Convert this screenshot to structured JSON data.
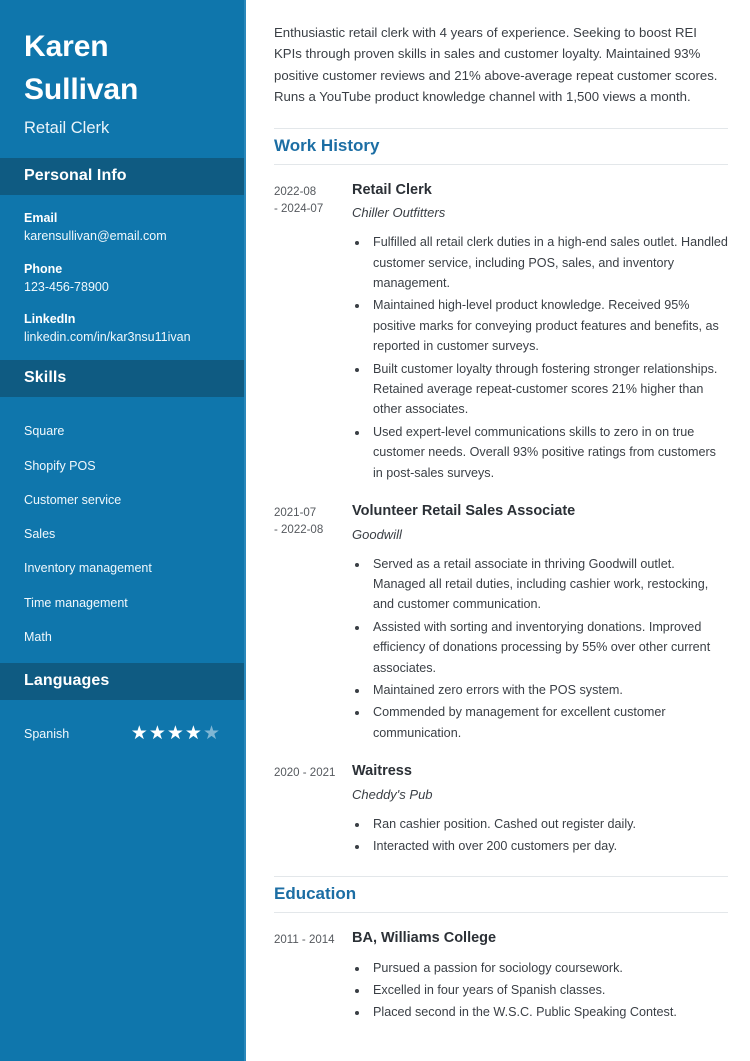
{
  "sidebar": {
    "name_first": "Karen",
    "name_last": "Sullivan",
    "job_title": "Retail Clerk",
    "personal_info": {
      "header": "Personal Info",
      "items": [
        {
          "label": "Email",
          "value": "karensullivan@email.com"
        },
        {
          "label": "Phone",
          "value": "123-456-78900"
        },
        {
          "label": "LinkedIn",
          "value": "linkedin.com/in/kar3nsu11ivan"
        }
      ]
    },
    "skills": {
      "header": "Skills",
      "items": [
        "Square",
        "Shopify POS",
        "Customer service",
        "Sales",
        "Inventory management",
        "Time management",
        "Math"
      ]
    },
    "languages": {
      "header": "Languages",
      "items": [
        {
          "name": "Spanish",
          "rating": 4,
          "max": 5
        }
      ]
    },
    "colors": {
      "background": "#0f76ac",
      "section_band": "#0f5b82",
      "edge_stripe": "#2a88bb",
      "star_on": "#ffffff",
      "star_off": "#7fb6d4"
    }
  },
  "main": {
    "summary": "Enthusiastic retail clerk with 4 years of experience. Seeking to boost REI KPIs through proven skills in sales and customer loyalty. Maintained 93% positive customer reviews and 21% above-average repeat customer scores. Runs a YouTube product knowledge channel with 1,500 views a month.",
    "work_history": {
      "heading": "Work History",
      "entries": [
        {
          "date_start": "2022-08",
          "date_end": "- 2024-07",
          "title": "Retail Clerk",
          "organization": "Chiller Outfitters",
          "bullets": [
            "Fulfilled all retail clerk duties in a high-end sales outlet. Handled customer service, including POS, sales, and inventory management.",
            "Maintained high-level product knowledge. Received 95% positive marks for conveying product features and benefits, as reported in customer surveys.",
            "Built customer loyalty through fostering stronger relationships. Retained average repeat-customer scores 21% higher than other associates.",
            "Used expert-level communications skills to zero in on true customer needs. Overall 93% positive ratings from customers in post-sales surveys."
          ]
        },
        {
          "date_start": "2021-07",
          "date_end": "- 2022-08",
          "title": "Volunteer Retail Sales Associate",
          "organization": "Goodwill",
          "bullets": [
            "Served as a retail associate in thriving Goodwill outlet. Managed all retail duties, including cashier work, restocking, and customer communication.",
            "Assisted with sorting and inventorying donations. Improved efficiency of donations processing by 55% over other current associates.",
            "Maintained zero errors with the POS system.",
            "Commended by management for excellent customer communication."
          ]
        },
        {
          "date_start": "2020  - 2021",
          "date_end": "",
          "title": "Waitress",
          "organization": "Cheddy's Pub",
          "bullets": [
            "Ran cashier position. Cashed out register daily.",
            "Interacted with over 200 customers per day."
          ]
        }
      ]
    },
    "education": {
      "heading": "Education",
      "entries": [
        {
          "date_start": "2011  - 2014",
          "date_end": "",
          "title": "BA, Williams College",
          "organization": "",
          "bullets": [
            "Pursued a passion for sociology coursework.",
            "Excelled in four years of Spanish classes.",
            "Placed second in the W.S.C. Public Speaking Contest."
          ]
        }
      ]
    },
    "colors": {
      "heading": "#1c6ea4",
      "text": "#3a3f45",
      "title": "#2b3036"
    }
  }
}
